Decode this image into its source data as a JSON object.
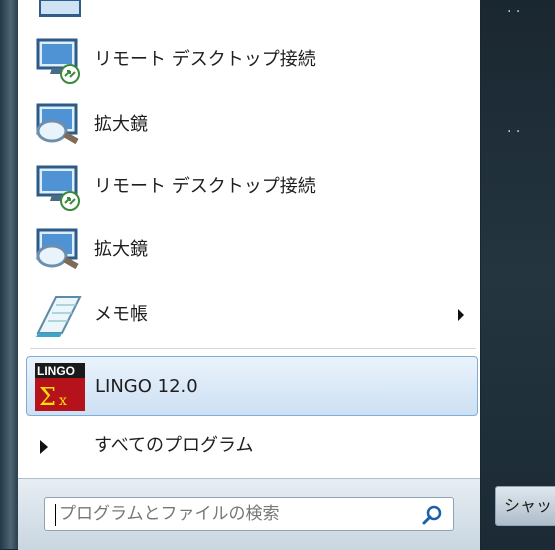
{
  "start_menu": {
    "items": [
      {
        "label": "リモート デスクトップ接続",
        "icon": "remote-desktop-icon"
      },
      {
        "label": "拡大鏡",
        "icon": "magnifier-icon"
      },
      {
        "label": "リモート デスクトップ接続",
        "icon": "remote-desktop-icon"
      },
      {
        "label": "拡大鏡",
        "icon": "magnifier-icon"
      },
      {
        "label": "メモ帳",
        "icon": "notepad-icon",
        "has_submenu": true
      },
      {
        "label": "LINGO 12.0",
        "icon": "lingo-icon",
        "selected": true
      }
    ],
    "all_programs_label": "すべてのプログラム",
    "search_placeholder": "プログラムとファイルの検索",
    "lingo_icon_text": "LINGO"
  },
  "right_pane": {
    "shutdown_label": "シャッ"
  },
  "colors": {
    "selection": "#cde0f3",
    "frame": "#243540"
  }
}
